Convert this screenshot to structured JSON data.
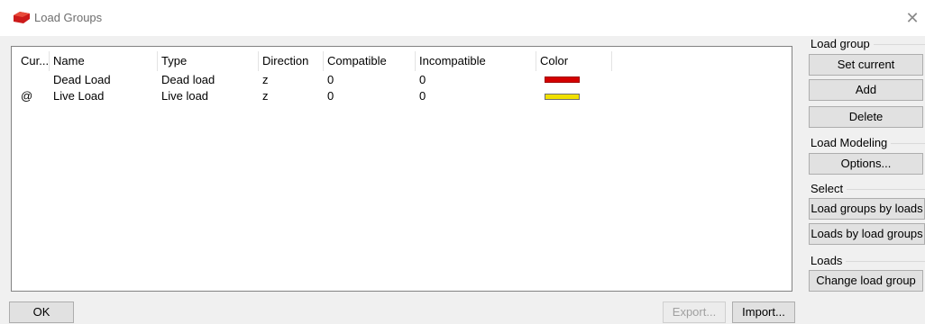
{
  "window": {
    "title": "Load Groups",
    "icon": "app-logo-icon",
    "close_icon": "close-icon"
  },
  "table": {
    "columns": [
      "Cur...",
      "Name",
      "Type",
      "Direction",
      "Compatible",
      "Incompatible",
      "Color"
    ],
    "rows": [
      {
        "current": "",
        "name": "Dead Load",
        "type": "Dead load",
        "direction": "z",
        "compatible": "0",
        "incompatible": "0",
        "color": "#d40000",
        "color_border": "#a00000"
      },
      {
        "current": "@",
        "name": "Live Load",
        "type": "Live load",
        "direction": "z",
        "compatible": "0",
        "incompatible": "0",
        "color": "#f0e000",
        "color_border": "#707070"
      }
    ]
  },
  "side": {
    "load_group": {
      "label": "Load group",
      "set_current": "Set current",
      "add": "Add",
      "delete": "Delete"
    },
    "load_modeling": {
      "label": "Load Modeling",
      "options": "Options..."
    },
    "select": {
      "label": "Select",
      "by_loads": "Load groups by loads",
      "by_groups": "Loads by load groups"
    },
    "loads": {
      "label": "Loads",
      "change": "Change load group"
    }
  },
  "footer": {
    "ok": "OK",
    "export": "Export...",
    "import": "Import..."
  }
}
